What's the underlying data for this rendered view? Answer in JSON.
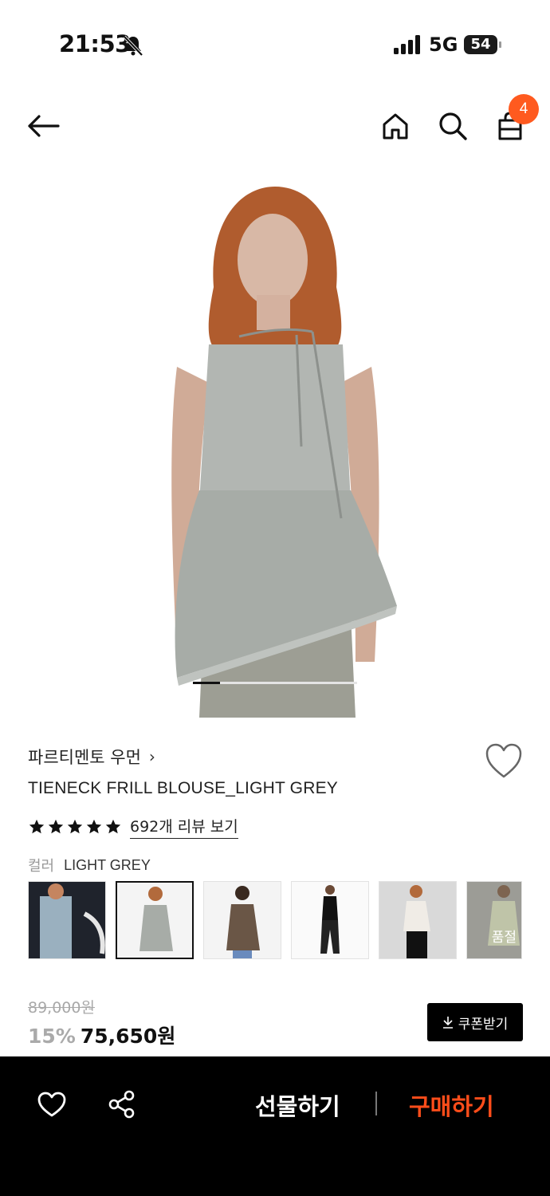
{
  "status": {
    "time": "21:53",
    "network": "5G",
    "battery": "54"
  },
  "header": {
    "cart_count": "4"
  },
  "product": {
    "brand": "파르티멘토 우먼",
    "title": "TIENECK FRILL BLOUSE_LIGHT GREY",
    "rating_stars": 5,
    "review_link": "692개 리뷰 보기",
    "color_label": "컬러",
    "color_value": "LIGHT GREY",
    "thumbnails": [
      {
        "label": "",
        "selected": false
      },
      {
        "label": "",
        "selected": true
      },
      {
        "label": "",
        "selected": false
      },
      {
        "label": "",
        "selected": false
      },
      {
        "label": "",
        "selected": false
      },
      {
        "label": "품절",
        "selected": false
      }
    ],
    "original_price": "89,000원",
    "discount": "15%",
    "sale_price": "75,650원",
    "coupon_label": "쿠폰받기"
  },
  "bottom_bar": {
    "gift_label": "선물하기",
    "buy_label": "구매하기"
  },
  "colors": {
    "accent": "#ff4d1a",
    "badge": "#ff5a1f"
  }
}
